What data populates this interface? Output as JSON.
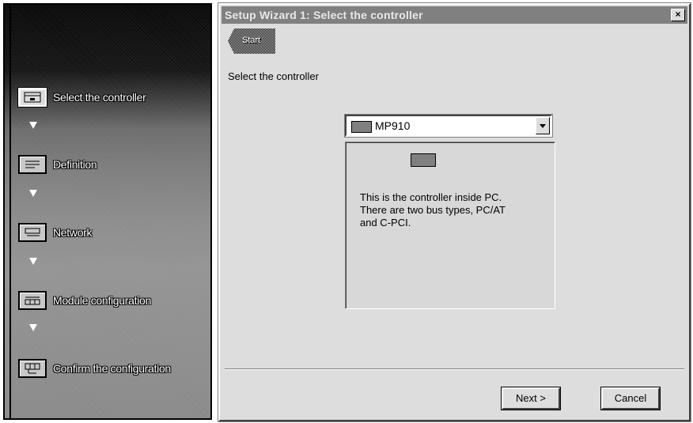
{
  "wizard": {
    "title": "Setup Wizard  1: Select the controller",
    "close_label": "×",
    "start_button_label": "Start",
    "heading": "Select the controller"
  },
  "steps": [
    {
      "label": "Select the controller",
      "icon": "controller-icon",
      "active": true
    },
    {
      "label": "Definition",
      "icon": "definition-icon",
      "active": false
    },
    {
      "label": "Network",
      "icon": "network-icon",
      "active": false
    },
    {
      "label": "Module configuration",
      "icon": "module-icon",
      "active": false
    },
    {
      "label": "Confirm the configuration",
      "icon": "confirm-icon",
      "active": false
    }
  ],
  "controller_select": {
    "selected": "MP910",
    "description": "This is the controller inside PC.\nThere are two bus types, PC/AT\nand C-PCI."
  },
  "buttons": {
    "next": "Next >",
    "cancel": "Cancel"
  },
  "colors": {
    "dialog_bg": "#dddddd",
    "titlebar_bg": "#808080",
    "panel_dark": "#0a0a0a"
  }
}
